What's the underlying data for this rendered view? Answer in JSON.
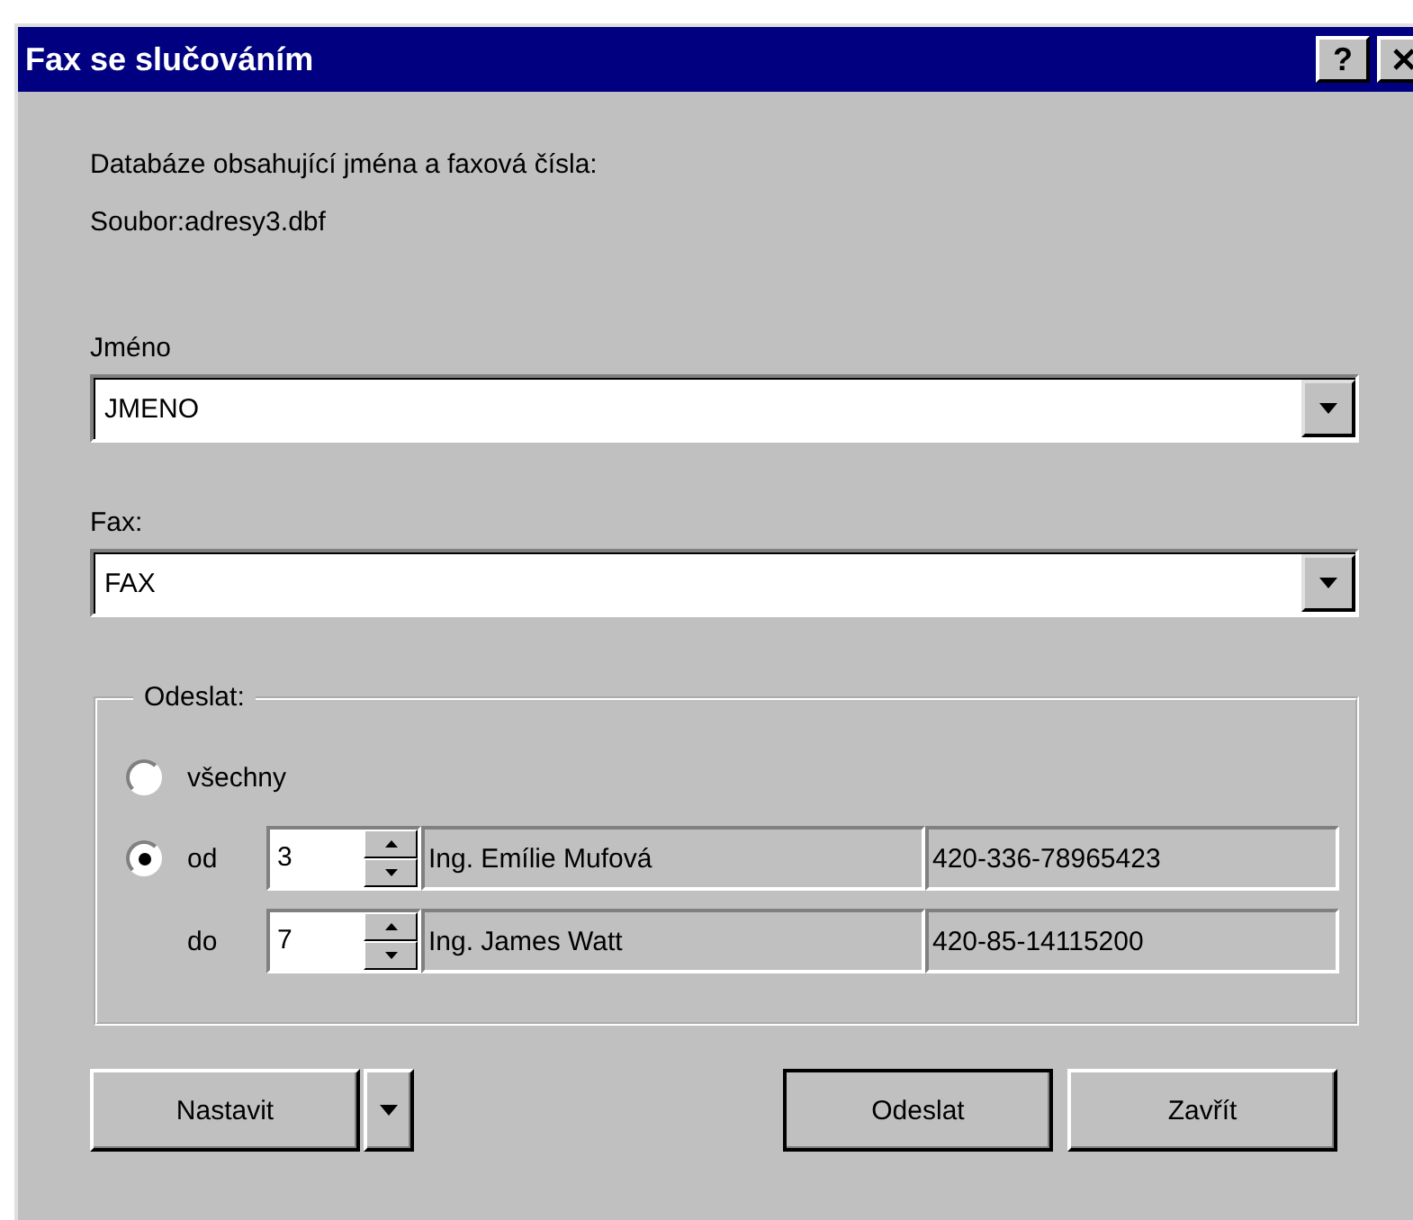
{
  "window": {
    "title": "Fax se slučováním",
    "help_button": "?"
  },
  "database": {
    "description": "Databáze obsahující jména a faxová čísla:",
    "file": "Soubor:adresy3.dbf"
  },
  "fields": [
    {
      "label": "Jméno",
      "value": "JMENO"
    },
    {
      "label": "Fax:",
      "value": "FAX"
    }
  ],
  "send_group": {
    "title": "Odeslat:",
    "rows": [
      {
        "kind": "radio",
        "label": "všechny",
        "selected": false
      },
      {
        "kind": "radio_range",
        "label": "od",
        "selected": true,
        "number": "3",
        "name": "Ing. Emílie Mufová",
        "fax": "420-336-78965423"
      },
      {
        "kind": "range",
        "label": "do",
        "number": "7",
        "name": "Ing. James Watt",
        "fax": "420-85-14115200"
      }
    ]
  },
  "buttons": [
    {
      "kind": "split",
      "label": "Nastavit"
    },
    {
      "kind": "default",
      "label": "Odeslat"
    },
    {
      "kind": "normal",
      "label": "Zavřít"
    }
  ]
}
